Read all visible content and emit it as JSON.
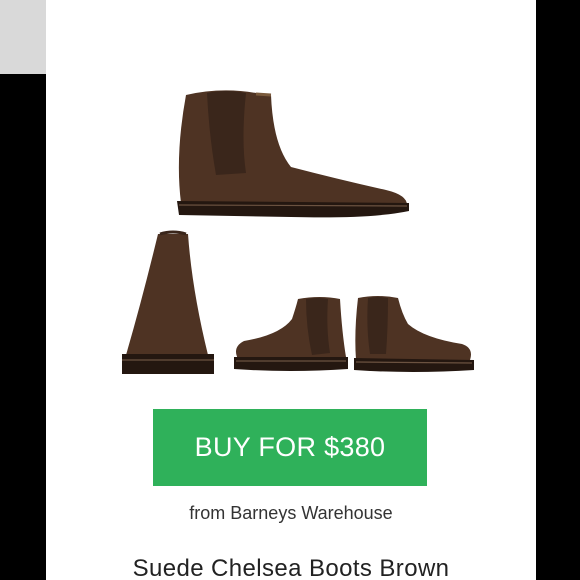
{
  "product": {
    "buy_label": "BUY FOR $380",
    "seller_text": "from Barneys Warehouse",
    "title": "Suede Chelsea Boots Brown"
  },
  "images": [
    {
      "name": "boot-side-view",
      "icon": "boot-side-icon"
    },
    {
      "name": "boot-rear-view",
      "icon": "boot-rear-icon"
    },
    {
      "name": "boot-left-side-view",
      "icon": "boot-side-icon"
    },
    {
      "name": "boot-right-side-view",
      "icon": "boot-side-icon"
    }
  ],
  "colors": {
    "suede": "#4e3323",
    "elastic": "#3a261b",
    "sole": "#241710",
    "button": "#2fb15a"
  }
}
